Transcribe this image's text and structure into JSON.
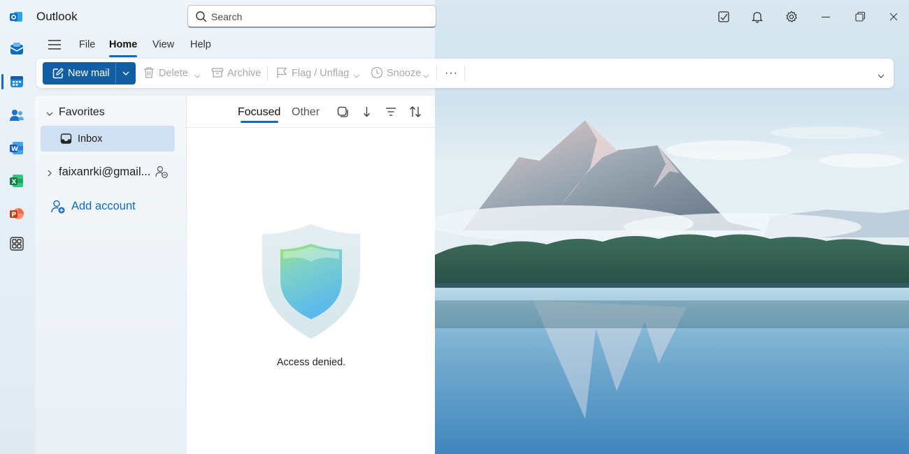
{
  "app": {
    "title": "Outlook"
  },
  "search": {
    "placeholder": "Search"
  },
  "titlebar_icons": [
    "sticky-note-icon",
    "bell-icon",
    "gear-icon",
    "minimize-icon",
    "restore-icon",
    "close-icon"
  ],
  "rail": {
    "items": [
      "mail-icon",
      "calendar-icon",
      "people-icon",
      "word-icon",
      "excel-icon",
      "powerpoint-icon",
      "apps-icon"
    ],
    "active": "mail-icon"
  },
  "ribbon": {
    "tabs": [
      "File",
      "Home",
      "View",
      "Help"
    ],
    "active_tab": "Home",
    "new_mail": "New mail",
    "delete": "Delete",
    "archive": "Archive",
    "flag": "Flag / Unflag",
    "snooze": "Snooze",
    "more": "···"
  },
  "folders": {
    "favorites": "Favorites",
    "inbox": "Inbox",
    "account": "faixanrki@gmail...",
    "add_account": "Add account"
  },
  "list": {
    "tabs": {
      "focused": "Focused",
      "other": "Other"
    },
    "empty_message": "Access denied."
  },
  "colors": {
    "accent": "#0f6cbd",
    "new_mail_button": "#115ea3",
    "selected_folder": "#cfe0f3"
  }
}
